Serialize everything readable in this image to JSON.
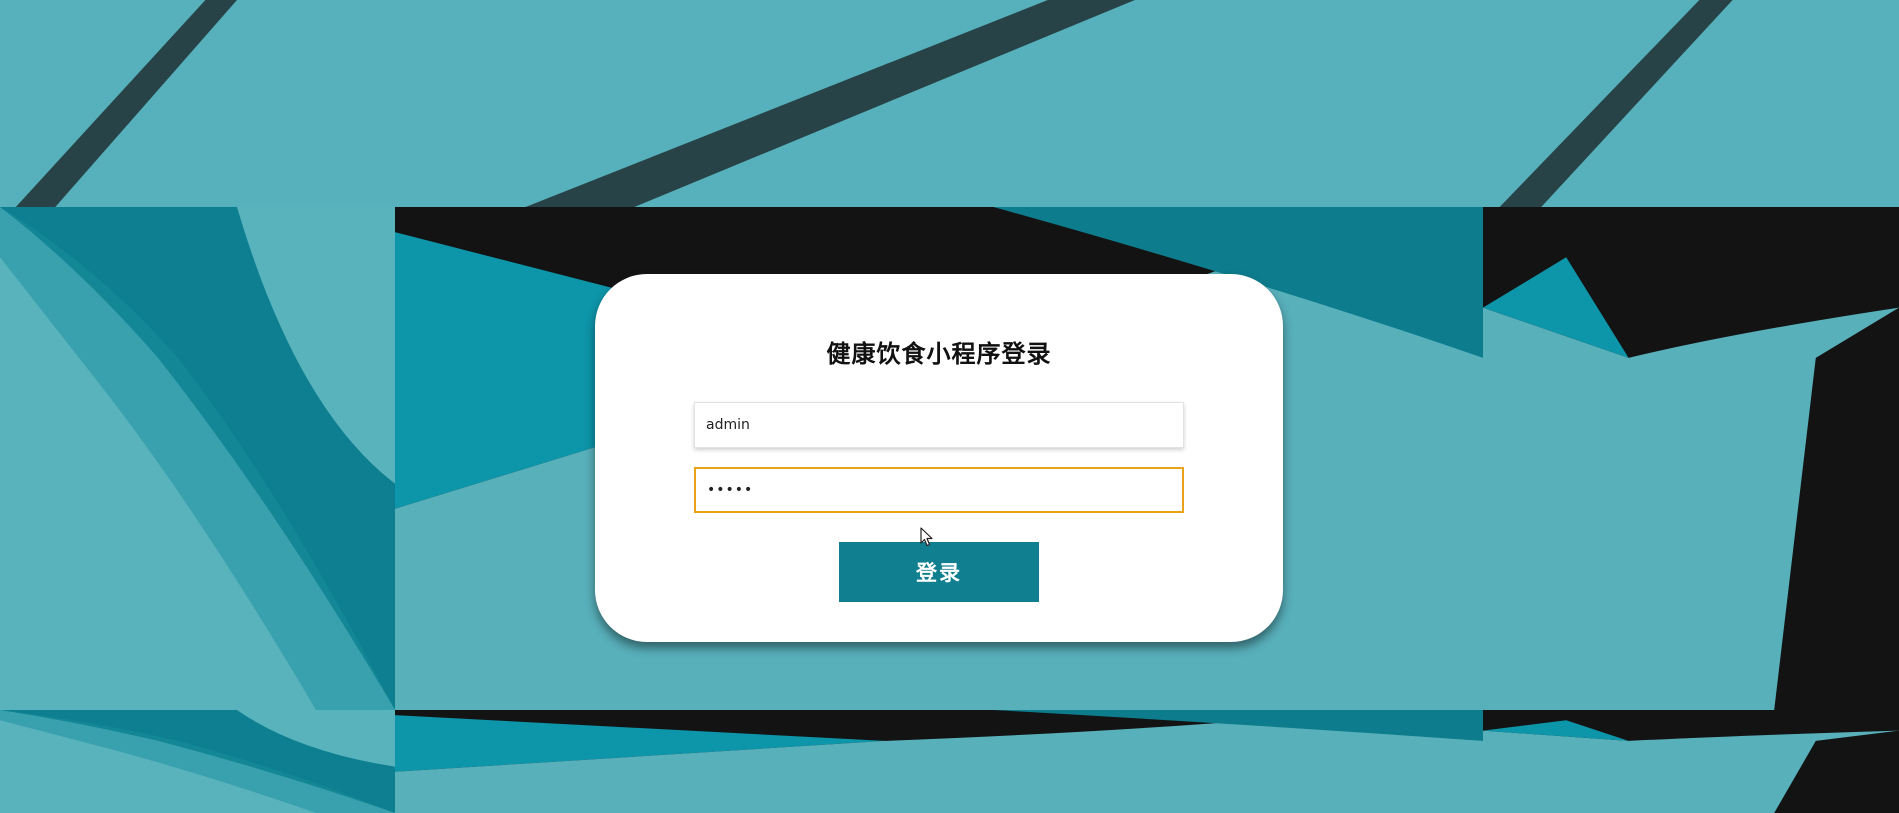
{
  "login": {
    "title": "健康饮食小程序登录",
    "username_value": "admin",
    "password_value": "•••••",
    "submit_label": "登录"
  },
  "colors": {
    "background_teal": "#56b0bb",
    "background_dark": "#111111",
    "background_deep_teal": "#107f90",
    "card": "#ffffff",
    "button": "#107f90",
    "button_text": "#ffffff",
    "focus_border": "#e8a317"
  },
  "icons": {
    "cursor": "arrow-pointer-icon"
  }
}
